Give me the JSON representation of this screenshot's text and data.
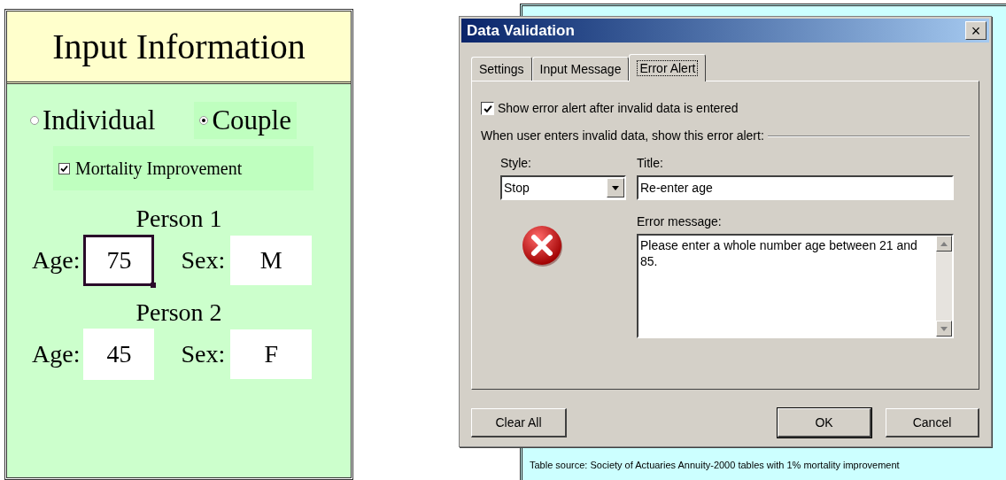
{
  "input_panel": {
    "title": "Input Information",
    "modes": [
      {
        "label": "Individual",
        "selected": false
      },
      {
        "label": "Couple",
        "selected": true
      }
    ],
    "mortality_improvement": {
      "label": "Mortality Improvement",
      "checked": true
    },
    "persons": [
      {
        "heading": "Person 1",
        "age_label": "Age:",
        "age": "75",
        "age_selected": true,
        "sex_label": "Sex:",
        "sex": "M"
      },
      {
        "heading": "Person 2",
        "age_label": "Age:",
        "age": "45",
        "age_selected": false,
        "sex_label": "Sex:",
        "sex": "F"
      }
    ]
  },
  "dialog": {
    "title": "Data Validation",
    "close": "×",
    "tabs": [
      {
        "label": "Settings",
        "selected": false
      },
      {
        "label": "Input Message",
        "selected": false
      },
      {
        "label": "Error Alert",
        "selected": true
      }
    ],
    "show_alert": {
      "label": "Show error alert after invalid data is entered",
      "checked": true
    },
    "group_label": "When user enters invalid data, show this error alert:",
    "style_label": "Style:",
    "style": "Stop",
    "title_label": "Title:",
    "title_value": "Re-enter age",
    "message_label": "Error message:",
    "message": "Please enter a whole number age between 21 and 85.",
    "buttons": [
      {
        "label": "Clear All",
        "default": false
      },
      {
        "label": "OK",
        "default": true
      },
      {
        "label": "Cancel",
        "default": false
      }
    ]
  },
  "footnote": "Table source: Society of Actuaries Annuity-2000 tables with 1% mortality improvement"
}
